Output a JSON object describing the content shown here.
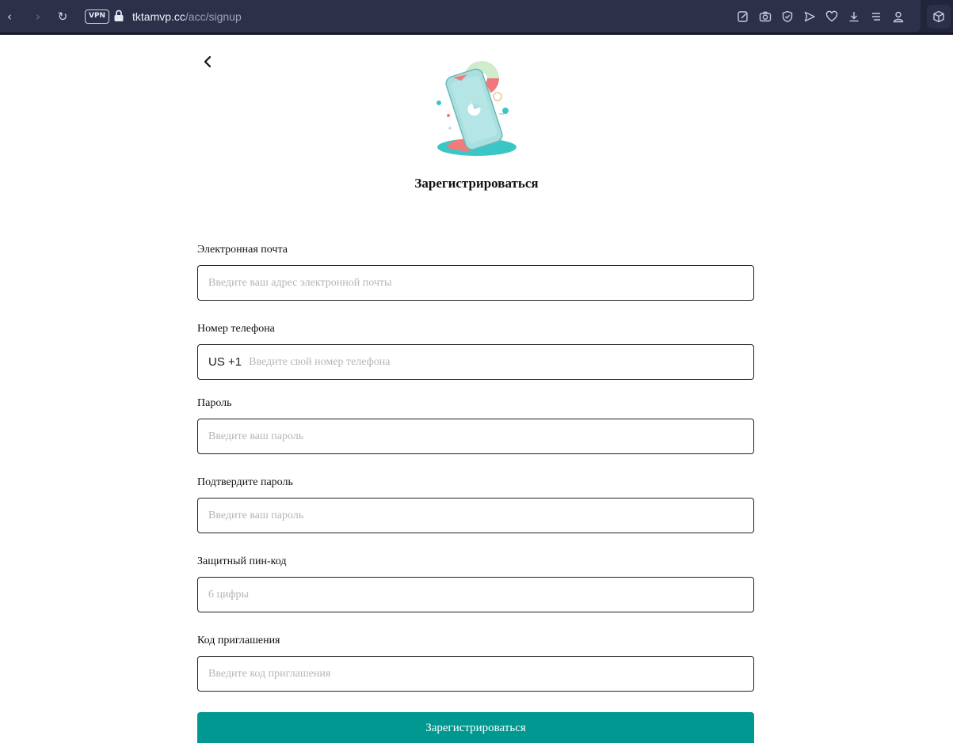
{
  "browser": {
    "vpn_label": "VPN",
    "url_host": "tktamvp.cc",
    "url_path": "/acc/signup",
    "nav_back": "‹",
    "nav_forward": "›",
    "nav_reload": "↻"
  },
  "page": {
    "title": "Зарегистрироваться"
  },
  "form": {
    "email": {
      "label": "Электронная почта",
      "placeholder": "Введите ваш адрес электронной почты"
    },
    "phone": {
      "label": "Номер телефона",
      "country_code": "US +1",
      "placeholder": "Введите свой номер телефона"
    },
    "password": {
      "label": "Пароль",
      "placeholder": "Введите ваш пароль"
    },
    "confirm_password": {
      "label": "Подтвердите пароль",
      "placeholder": "Введите ваш пароль"
    },
    "pin": {
      "label": "Защитный пин-код",
      "placeholder": "6 цифры"
    },
    "invite": {
      "label": "Код приглашения",
      "placeholder": "Введите код приглашения"
    },
    "submit_label": "Зарегистрироваться"
  },
  "colors": {
    "accent": "#009891",
    "chrome_bg": "#2c3048"
  }
}
